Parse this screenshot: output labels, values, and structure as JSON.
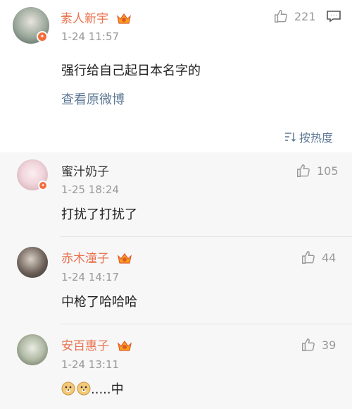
{
  "main": {
    "author": "素人新宇",
    "time": "1-24 11:57",
    "likes": "221",
    "text": "强行给自己起日本名字的",
    "view_original": "查看原微博",
    "sort_label": "按热度"
  },
  "replies": [
    {
      "author": "蜜汁奶子",
      "time": "1-25 18:24",
      "likes": "105",
      "text": "打扰了打扰了"
    },
    {
      "author": "赤木潼子",
      "time": "1-24 14:17",
      "likes": "44",
      "text": "中枪了哈哈哈"
    },
    {
      "author": "安百惠子",
      "time": "1-24 13:11",
      "likes": "39",
      "text": ".....中"
    }
  ],
  "icons": {
    "like": "thumbs-up-icon",
    "comment": "comment-icon",
    "sort": "sort-icon",
    "crown": "crown-vip-icon",
    "emoji": "doge-emoji-icon"
  },
  "colors": {
    "accent_name": "#eb7350",
    "link": "#5d7895",
    "muted": "#999999",
    "reply_bg": "#f7f7f7"
  }
}
